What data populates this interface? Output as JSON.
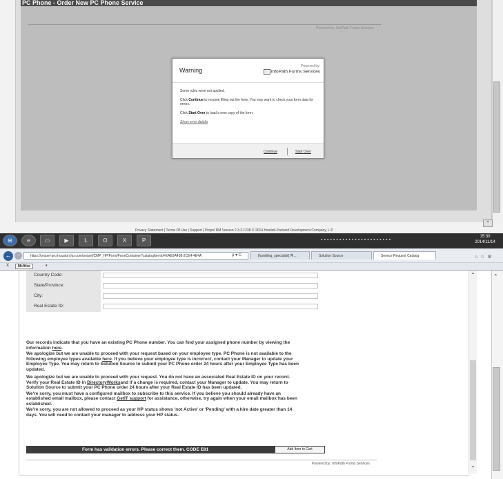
{
  "top": {
    "header_title": "PC Phone - Order New PC Phone Service",
    "powered_by": "Powered by: InfoPath Forms Services",
    "dialog": {
      "title": "Warning",
      "brand_powered": "Powered by:",
      "brand_name": "InfoPath Forms Services",
      "line1": "Some rules were not applied.",
      "line2_bold": "Continue",
      "line2_pre": "Click ",
      "line2_post": " to resume filling out the form. You may want to check your form data for errors.",
      "line3_pre": "Click ",
      "line3_bold": "Start Over",
      "line3_post": " to load a new copy of the form.",
      "error_link": "Show error details",
      "continue_label": "Continue",
      "start_over_label": "Start Over"
    },
    "footer": "Privacy Statement  |  Terms Of Use  |  Support  |  Propel RM Version 2.3.2.1238    © 2014 Hewlett-Packard Development Company, L.P."
  },
  "taskbar": {
    "clock_time": "15:30",
    "clock_date": "2014/11/14"
  },
  "browser": {
    "url": "https://propel-pro.houston.hp.com/propel/CMP_HP/Form/FormContainer?catalogItemId=EAE9A438-2CE4-4E4A",
    "tabs": [
      "[handling_specialist] 件...",
      "Solution Source",
      "Service Request Catalog"
    ],
    "close_label": "X",
    "mcafee_label": "McAfee"
  },
  "form": {
    "fields": [
      {
        "label": "Country Code:",
        "value": ""
      },
      {
        "label": "State/Province:",
        "value": ""
      },
      {
        "label": "City:",
        "value": ""
      },
      {
        "label": "Real Estate ID:",
        "value": ""
      }
    ],
    "msg1_pre": "Our records indicate that you have an existing PC Phone number. You can find your assigned phone number by viewing the information ",
    "msg1_link": "here",
    "msg1_post": ".",
    "msg2_pre": "We apologize but we are unable to proceed with your request based on your employee type. PC Phone is not available to the following employee types available ",
    "msg2_link": "here",
    "msg2_post": ". If you believe your employee type is incorrect, contact your Manager to update your Employee Type. You may return to Solution Source to submit your PC Phone order 24 hours after your Employee Type has been updated.",
    "msg3_pre": "We apologize but we are unable to proceed with your request. You do not have an associated Real Estate ID on your record. Verify your Real Estate ID in ",
    "msg3_link": "DirectoryWorks",
    "msg3_post": "and if a change is required, contact your Manager to update. You may return to Solution Source to submit your PC Phone order 24 hours after your Real Estate ID has been updated.",
    "msg4_pre": "We're sorry,  you must have a configured mailbox to subscribe to this service.  If you believe you should already have an established email mailbox, please contact ",
    "msg4_link": "GetIT support",
    "msg4_post": " for assistance, otherwise, try again when your email mailbox has been established.",
    "msg5": "We're sorry, you are not allowed to proceed as your HP status shows 'not Active'  or 'Pending' with a hire date  greater than 14 days. You will need to contact your manager to address your HP status.",
    "error_text": "Form has validation errors. Please correct them. CODE E81",
    "add_button": "Add Item to Cart",
    "powered_by": "Powered by: InfoPath Forms Services"
  }
}
